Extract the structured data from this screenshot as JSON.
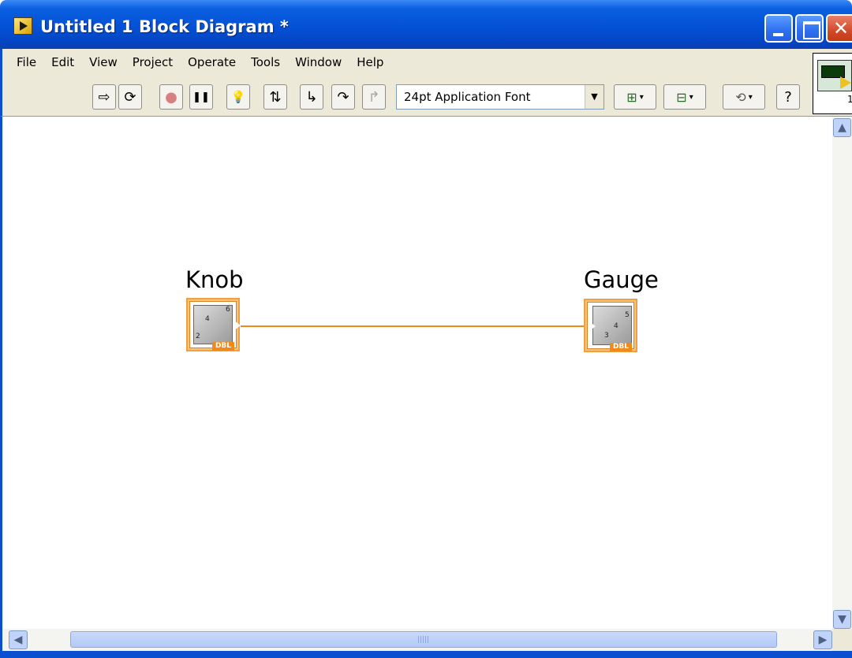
{
  "window": {
    "title": "Untitled 1 Block Diagram *",
    "title_color": "#0451d6",
    "controls": [
      "minimize",
      "maximize",
      "close"
    ]
  },
  "menu": {
    "items": [
      "File",
      "Edit",
      "View",
      "Project",
      "Operate",
      "Tools",
      "Window",
      "Help"
    ]
  },
  "toolbar": {
    "run_icon": "⇨",
    "run_continuously_icon": "⟳",
    "abort_icon": "●",
    "pause_icon": "❚❚",
    "highlight_icon": "💡",
    "retain_wire_values_icon": "⇅",
    "step_into_icon": "↳",
    "step_over_icon": "↷",
    "step_out_icon": "↱",
    "font_selector": "24pt Application Font",
    "font_dropdown_arrow": "▼",
    "align_dropdown_arrow": "▾",
    "distribute_dropdown_arrow": "▾",
    "reorder_dropdown_arrow": "▾",
    "help_icon": "?",
    "connector_pane_number": "1"
  },
  "diagram": {
    "wire_color": "#f08a1a",
    "nodes": [
      {
        "label": "Knob",
        "type_badge": "DBL",
        "icon": "knob-icon",
        "scale_marks": [
          "2",
          "4",
          "6"
        ]
      },
      {
        "label": "Gauge",
        "type_badge": "DBL",
        "icon": "gauge-icon",
        "scale_marks": [
          "3",
          "4",
          "5"
        ]
      }
    ]
  },
  "scrollbars": {
    "up_arrow": "▲",
    "down_arrow": "▼",
    "left_arrow": "◀",
    "right_arrow": "▶"
  }
}
